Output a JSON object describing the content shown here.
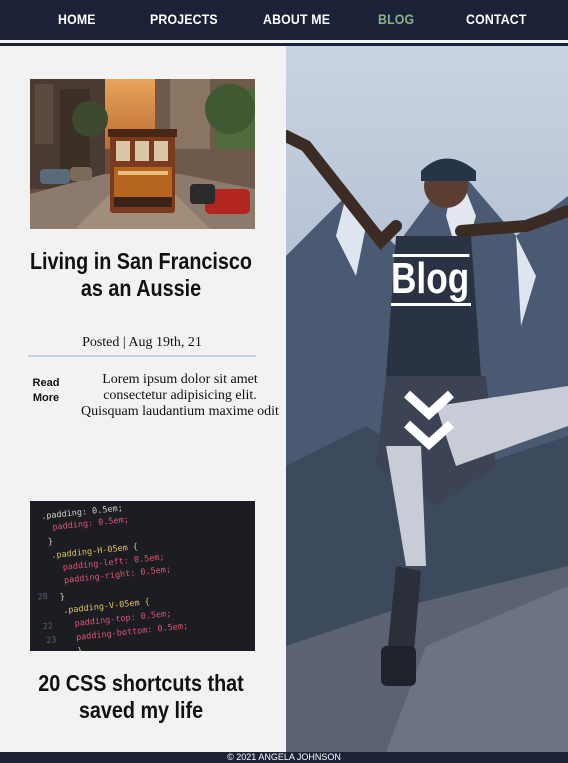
{
  "nav": {
    "items": [
      {
        "label": "HOME",
        "active": false
      },
      {
        "label": "PROJECTS",
        "active": false
      },
      {
        "label": "ABOUT ME",
        "active": false
      },
      {
        "label": "BLOG",
        "active": true
      },
      {
        "label": "CONTACT",
        "active": false
      }
    ],
    "active_color": "#8bb08a",
    "background": "#1b2238"
  },
  "posts": [
    {
      "title": "Living in San Francisco as an Aussie",
      "posted": "Posted | Aug 19th, 21",
      "read_more": "Read More",
      "excerpt": "Lorem ipsum dolor sit amet consectetur adipisicing elit. Quisquam laudantium maxime odit",
      "image": "san-francisco-cable-car"
    },
    {
      "title": "20 CSS shortcuts that saved my life",
      "image": "css-code-screen",
      "code_lines": [
        {
          "num": "",
          "text": ".padding: 0.5em;"
        },
        {
          "num": "",
          "text": "  padding: 0.5em;"
        },
        {
          "num": "",
          "text": "}"
        },
        {
          "num": "",
          "text": ".padding-H-05em {"
        },
        {
          "num": "",
          "text": "  padding-left: 0.5em;"
        },
        {
          "num": "",
          "text": "  padding-right: 0.5em;"
        },
        {
          "num": "28",
          "text": ""
        },
        {
          "num": "",
          "text": "}"
        },
        {
          "num": "",
          "text": ".padding-V-05em {"
        },
        {
          "num": "22",
          "text": "  padding-top: 0.5em;"
        },
        {
          "num": "23",
          "text": "  padding-bottom: 0.5em;"
        },
        {
          "num": "",
          "text": "}"
        }
      ]
    }
  ],
  "hero": {
    "heading": "Blog",
    "scroll_icon": "double-chevron-down-icon"
  },
  "footer": {
    "text": "© 2021 ANGELA JOHNSON"
  }
}
